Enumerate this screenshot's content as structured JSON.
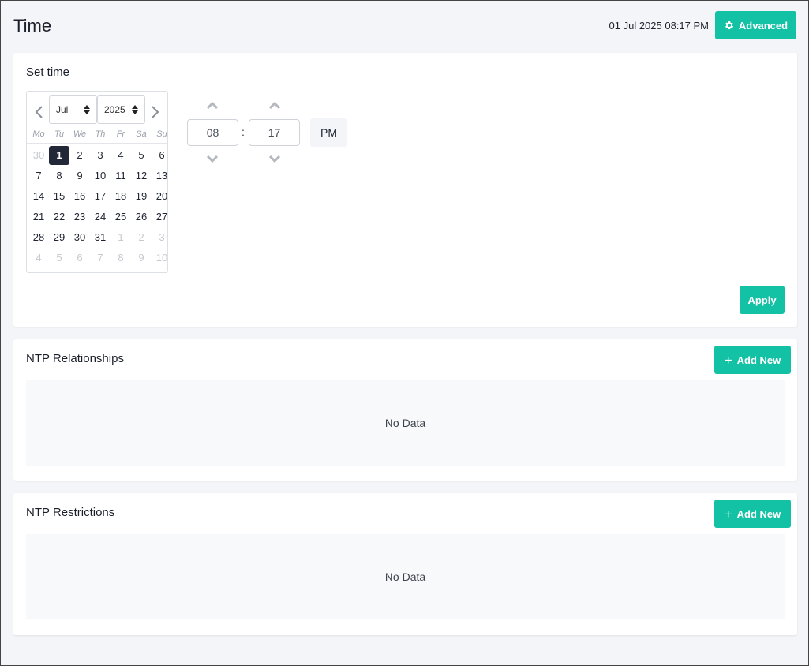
{
  "header": {
    "title": "Time",
    "current_datetime": "01 Jul 2025 08:17 PM",
    "advanced_label": "Advanced"
  },
  "set_time": {
    "title": "Set time",
    "calendar": {
      "month": "Jul",
      "year": "2025",
      "weekdays": [
        "Mo",
        "Tu",
        "We",
        "Th",
        "Fr",
        "Sa",
        "Su"
      ],
      "weeks": [
        [
          "30",
          "1",
          "2",
          "3",
          "4",
          "5",
          "6"
        ],
        [
          "7",
          "8",
          "9",
          "10",
          "11",
          "12",
          "13"
        ],
        [
          "14",
          "15",
          "16",
          "17",
          "18",
          "19",
          "20"
        ],
        [
          "21",
          "22",
          "23",
          "24",
          "25",
          "26",
          "27"
        ],
        [
          "28",
          "29",
          "30",
          "31",
          "1",
          "2",
          "3"
        ],
        [
          "4",
          "5",
          "6",
          "7",
          "8",
          "9",
          "10"
        ]
      ],
      "selected_day": "1"
    },
    "hour": "08",
    "minute": "17",
    "separator": ":",
    "meridiem": "PM",
    "apply_label": "Apply"
  },
  "ntp_relationships": {
    "title": "NTP Relationships",
    "add_label": "Add New",
    "empty_text": "No Data"
  },
  "ntp_restrictions": {
    "title": "NTP Restrictions",
    "add_label": "Add New",
    "empty_text": "No Data"
  },
  "colors": {
    "accent": "#13c1a5",
    "selected_day_bg": "#232838"
  }
}
